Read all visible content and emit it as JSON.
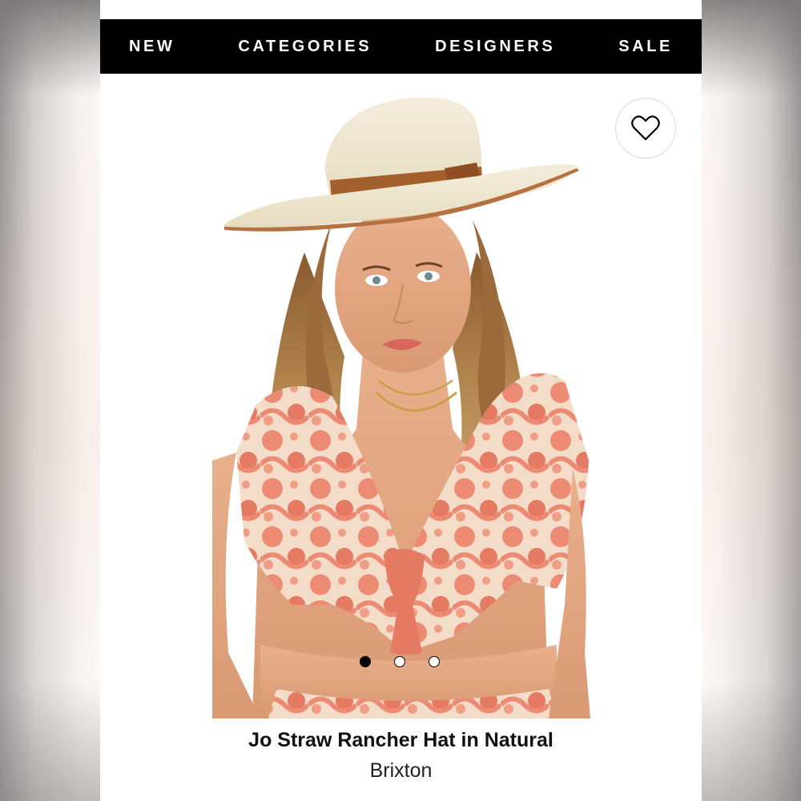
{
  "nav": {
    "items": [
      {
        "label": "NEW"
      },
      {
        "label": "CATEGORIES"
      },
      {
        "label": "DESIGNERS"
      },
      {
        "label": "SALE"
      }
    ]
  },
  "product": {
    "title": "Jo Straw Rancher Hat in Natural",
    "brand": "Brixton",
    "wishlist_icon": "heart-outline-icon",
    "carousel": {
      "count": 3,
      "active_index": 0
    }
  },
  "colors": {
    "nav_background": "#000000",
    "nav_text": "#ffffff",
    "hat_straw": "#efe6cf",
    "hat_band": "#a45f2e",
    "top_print": "#ec8a73"
  }
}
